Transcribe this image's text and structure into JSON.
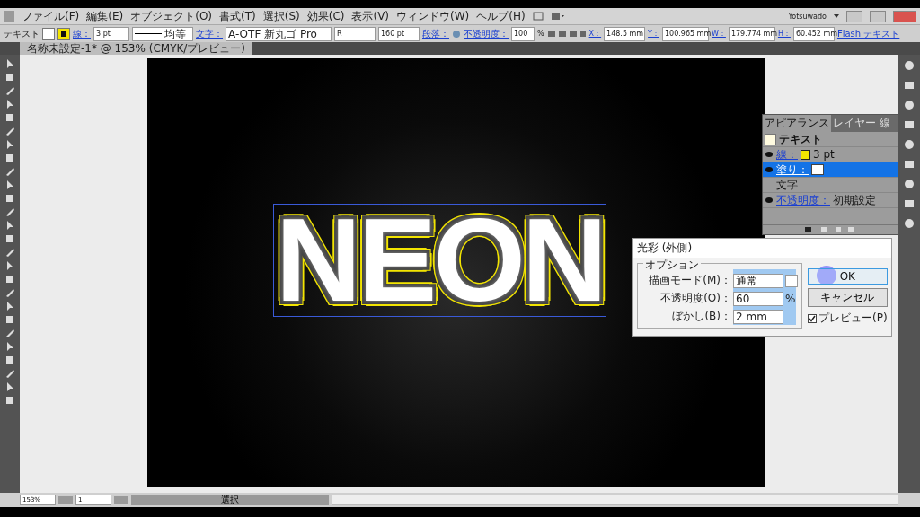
{
  "menu_bar": {
    "items": [
      "ファイル(F)",
      "編集(E)",
      "オブジェクト(O)",
      "書式(T)",
      "選択(S)",
      "効果(C)",
      "表示(V)",
      "ウィンドウ(W)",
      "ヘルプ(H)"
    ],
    "user": "Yotsuwado"
  },
  "control_bar": {
    "object_type": "テキスト",
    "stroke_label": "線：",
    "stroke_weight": "3 pt",
    "stroke_profile": "均等",
    "character_label": "文字：",
    "font_family": "A-OTF 新丸ゴ Pro",
    "font_style": "R",
    "font_size": "160 pt",
    "paragraph_label": "段落：",
    "opacity_label": "不透明度：",
    "opacity": "100",
    "opacity_unit": "%",
    "x_label": "X：",
    "x": "148.5 mm",
    "y_label": "Y：",
    "y": "100.965 mm",
    "w_label": "W：",
    "w": "179.774 mm",
    "h_label": "H：",
    "h": "60.452 mm",
    "flash_link": "Flash テキスト"
  },
  "document_tab": {
    "title": "名称未設定-1* @ 153% (CMYK/プレビュー)"
  },
  "artboard": {
    "text": "NEON"
  },
  "dialog": {
    "title": "光彩 (外側)",
    "group_label": "オプション",
    "mode_label": "描画モード(M)：",
    "mode_value": "通常",
    "opacity_label": "不透明度(O)：",
    "opacity_value": "60",
    "opacity_unit": "%",
    "blur_label": "ぼかし(B)：",
    "blur_value": "2 mm",
    "ok": "OK",
    "cancel": "キャンセル",
    "preview": {
      "label": "プレビュー(P)",
      "checked": true
    }
  },
  "appearance_panel": {
    "tabs": [
      {
        "label": "アピアランス",
        "selected": true
      },
      {
        "label": "レイヤー",
        "selected": false
      },
      {
        "label": "線",
        "selected": false
      }
    ],
    "title_row": "テキスト",
    "rows": [
      {
        "kind": "stroke",
        "label": "線：",
        "value": "3 pt",
        "selected": false
      },
      {
        "kind": "fill",
        "label": "塗り：",
        "selected": true
      },
      {
        "kind": "plain",
        "label": "文字",
        "selected": false
      },
      {
        "kind": "opacity",
        "label": "不透明度：",
        "value": "初期設定",
        "selected": false
      }
    ]
  },
  "status_bar": {
    "zoom": "153%",
    "artboard": "1",
    "tool": "選択"
  }
}
